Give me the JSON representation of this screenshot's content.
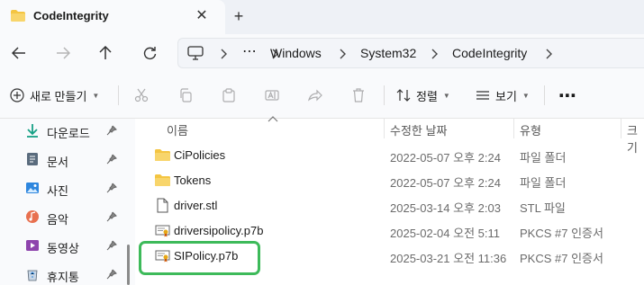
{
  "tab": {
    "title": "CodeIntegrity",
    "close": "✕",
    "new": "+"
  },
  "breadcrumb": {
    "more": "⋯",
    "items": [
      "Windows",
      "System32",
      "CodeIntegrity"
    ]
  },
  "commands": {
    "new_label": "새로 만들기",
    "sort_label": "정렬",
    "view_label": "보기",
    "more": "⋯"
  },
  "sidebar": {
    "items": [
      {
        "label": "다운로드",
        "icon": "download-icon"
      },
      {
        "label": "문서",
        "icon": "document-icon"
      },
      {
        "label": "사진",
        "icon": "pictures-icon"
      },
      {
        "label": "음악",
        "icon": "music-icon"
      },
      {
        "label": "동영상",
        "icon": "video-icon"
      },
      {
        "label": "휴지통",
        "icon": "recycle-bin-icon"
      }
    ]
  },
  "columns": {
    "name": "이름",
    "modified": "수정한 날짜",
    "type": "유형",
    "size": "크기"
  },
  "files": [
    {
      "name": "CiPolicies",
      "date": "2022-05-07 오후 2:24",
      "type": "파일 폴더",
      "icon": "folder-icon"
    },
    {
      "name": "Tokens",
      "date": "2022-05-07 오후 2:24",
      "type": "파일 폴더",
      "icon": "folder-icon"
    },
    {
      "name": "driver.stl",
      "date": "2025-03-14 오후 2:03",
      "type": "STL 파일",
      "icon": "file-icon"
    },
    {
      "name": "driversipolicy.p7b",
      "date": "2025-02-04 오전 5:11",
      "type": "PKCS #7 인증서",
      "icon": "certificate-icon"
    },
    {
      "name": "SIPolicy.p7b",
      "date": "2025-03-21 오전 11:36",
      "type": "PKCS #7 인증서",
      "icon": "certificate-icon"
    }
  ],
  "colors": {
    "folder": "#f4c542",
    "highlight": "#3dba5a",
    "accent": "#1a73c7"
  }
}
